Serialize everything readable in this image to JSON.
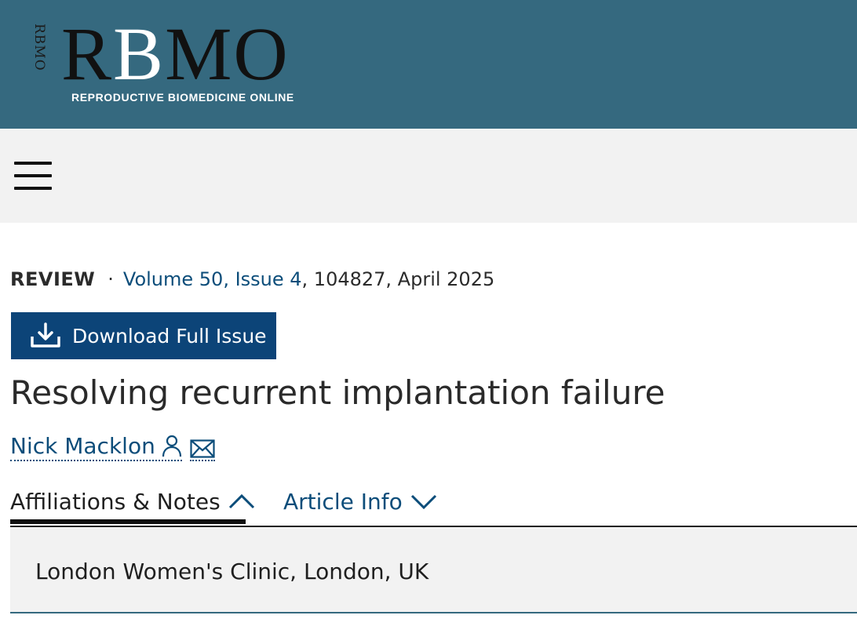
{
  "header": {
    "logo_vertical": "RBMO",
    "logo_main": "RBMO",
    "logo_subtitle": "REPRODUCTIVE BIOMEDICINE ONLINE",
    "brand_color": "#35697f"
  },
  "nav": {
    "menu_icon": "hamburger-menu-icon"
  },
  "article": {
    "type": "REVIEW",
    "separator": "·",
    "volume_issue": "Volume 50, Issue 4",
    "citation_rest": ", 104827, April 2025",
    "download_label": "Download Full Issue",
    "download_icon": "download-icon",
    "title": "Resolving recurrent implantation failure",
    "author": "Nick Macklon",
    "author_icon": "person-icon",
    "email_icon": "envelope-icon"
  },
  "tabs": [
    {
      "label": "Affiliations & Notes",
      "state": "expanded",
      "icon": "chevron-up-icon"
    },
    {
      "label": "Article Info",
      "state": "collapsed",
      "icon": "chevron-down-icon"
    }
  ],
  "affiliations": [
    "London Women's Clinic, London, UK"
  ],
  "colors": {
    "link": "#0c4d7a",
    "button": "#0c4478",
    "panel_bg": "#f2f2f2"
  }
}
